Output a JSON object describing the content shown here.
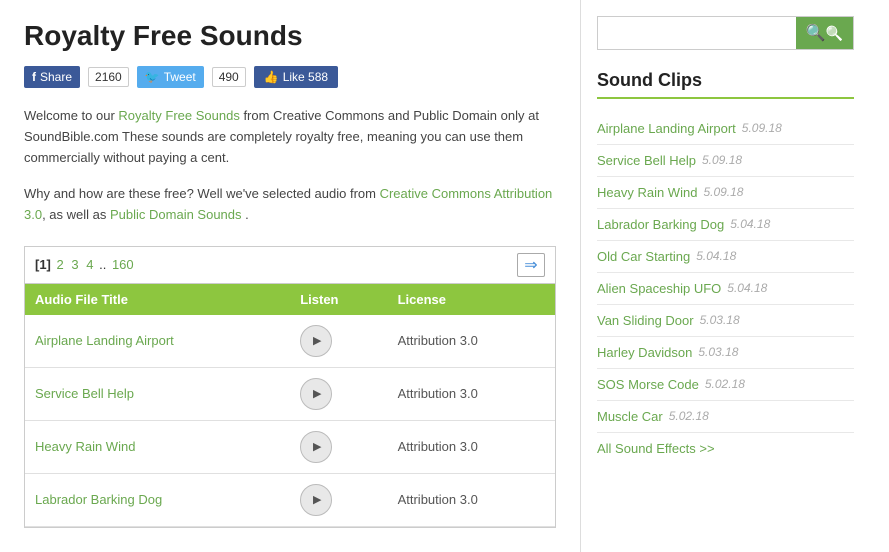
{
  "page": {
    "title": "Royalty Free Sounds",
    "intro": "Welcome to our ",
    "intro_link": "Royalty Free Sounds",
    "intro_cont": " from Creative Commons and Public Domain only at SoundBible.com These sounds are completely royalty free, meaning you can use them commercially without paying a cent.",
    "why_pre": "Why and how are these free? Well we've selected audio from ",
    "why_link1": "Creative Commons Attribution 3.0",
    "why_mid": ", as well as ",
    "why_link2": "Public Domain Sounds",
    "why_post": " ."
  },
  "social": {
    "fb_share": "Share",
    "fb_count": "2160",
    "tw_tweet": "Tweet",
    "tw_count": "490",
    "like_label": "Like 588"
  },
  "table": {
    "nav_current": "[1]",
    "nav_pages": "2 3 4 ..160",
    "col_title": "Audio File Title",
    "col_listen": "Listen",
    "col_license": "License",
    "rows": [
      {
        "title": "Airplane Landing Airport",
        "license": "Attribution 3.0"
      },
      {
        "title": "Service Bell Help",
        "license": "Attribution 3.0"
      },
      {
        "title": "Heavy Rain Wind",
        "license": "Attribution 3.0"
      },
      {
        "title": "Labrador Barking Dog",
        "license": "Attribution 3.0"
      }
    ]
  },
  "sidebar": {
    "search_placeholder": "",
    "sound_clips_title": "Sound Clips",
    "clips": [
      {
        "name": "Airplane Landing Airport",
        "date": "5.09.18"
      },
      {
        "name": "Service Bell Help",
        "date": "5.09.18"
      },
      {
        "name": "Heavy Rain Wind",
        "date": "5.09.18"
      },
      {
        "name": "Labrador Barking Dog",
        "date": "5.04.18"
      },
      {
        "name": "Old Car Starting",
        "date": "5.04.18"
      },
      {
        "name": "Alien Spaceship UFO",
        "date": "5.04.18"
      },
      {
        "name": "Van Sliding Door",
        "date": "5.03.18"
      },
      {
        "name": "Harley Davidson",
        "date": "5.03.18"
      },
      {
        "name": "SOS Morse Code",
        "date": "5.02.18"
      },
      {
        "name": "Muscle Car",
        "date": "5.02.18"
      }
    ],
    "all_effects": "All Sound Effects >>"
  }
}
